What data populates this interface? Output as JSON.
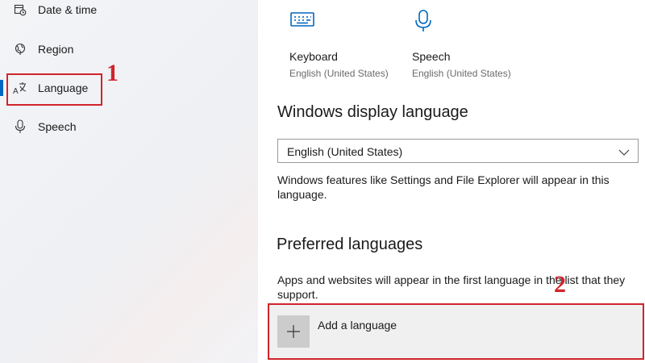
{
  "sidebar": {
    "items": [
      {
        "label": "Date & time",
        "icon": "calendar-clock-icon"
      },
      {
        "label": "Region",
        "icon": "globe-icon"
      },
      {
        "label": "Language",
        "icon": "language-icon",
        "selected": true
      },
      {
        "label": "Speech",
        "icon": "microphone-icon"
      }
    ],
    "accent": "#0067c0"
  },
  "tiles": [
    {
      "title": "Keyboard",
      "subtitle": "English (United States)",
      "icon": "keyboard-icon"
    },
    {
      "title": "Speech",
      "subtitle": "English (United States)",
      "icon": "microphone-icon"
    }
  ],
  "display_language": {
    "heading": "Windows display language",
    "selected": "English (United States)",
    "description": "Windows features like Settings and File Explorer will appear in this language."
  },
  "preferred": {
    "heading": "Preferred languages",
    "description": "Apps and websites will appear in the first language in the list that they support.",
    "add_label": "Add a language"
  },
  "annotations": {
    "step1": "1",
    "step2": "2",
    "color": "#d0242b"
  }
}
